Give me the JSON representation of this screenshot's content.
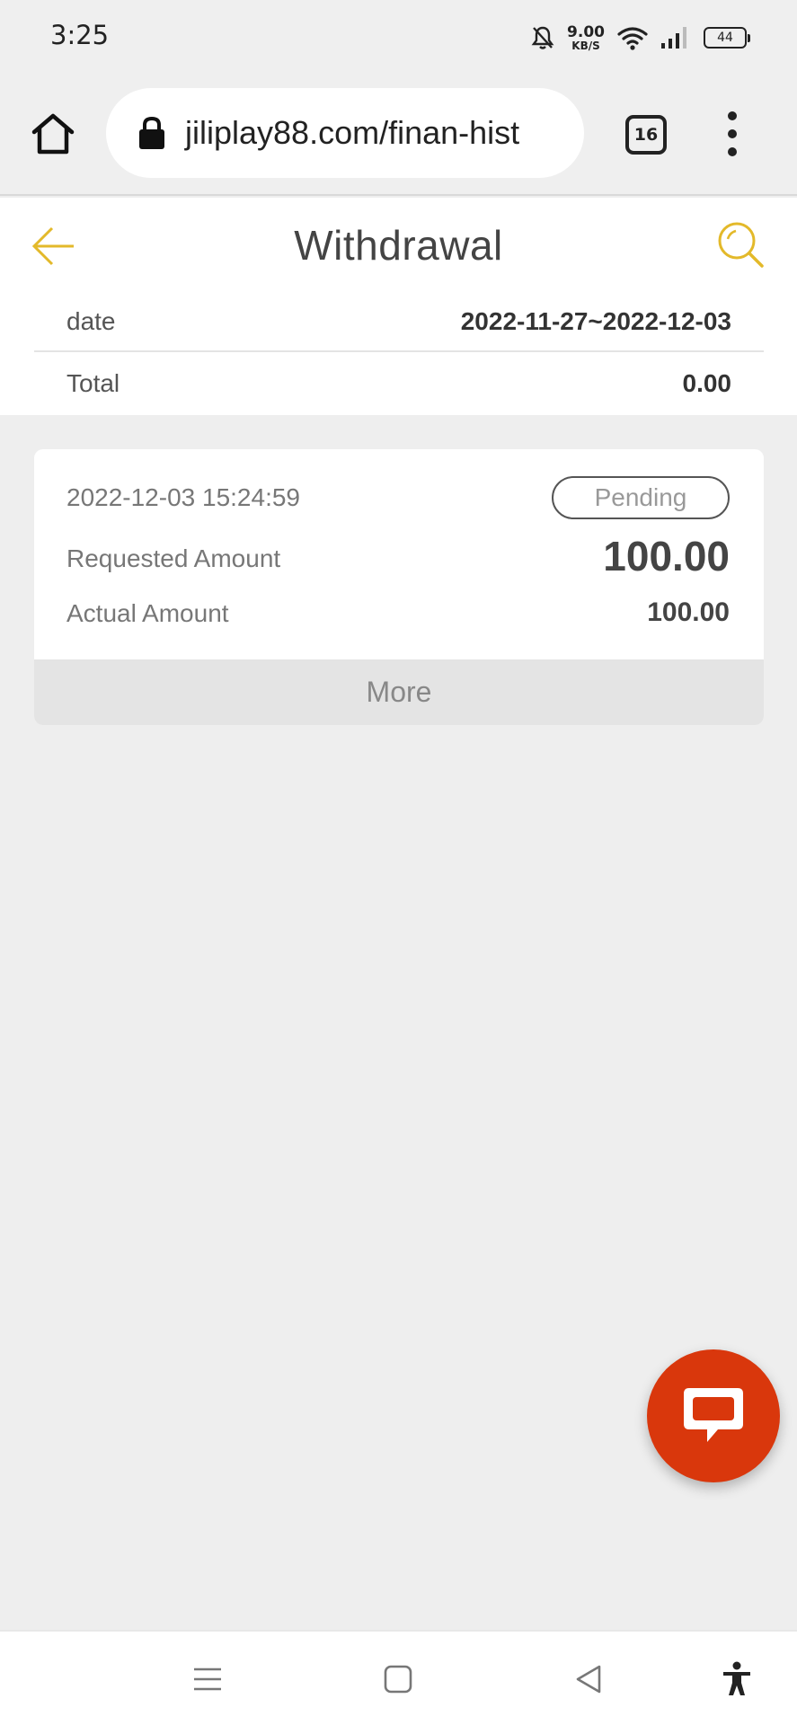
{
  "status_bar": {
    "time": "3:25",
    "net_speed_value": "9.00",
    "net_speed_unit": "KB/S",
    "battery": "44"
  },
  "browser": {
    "url": "jiliplay88.com/finan-hist",
    "tab_count": "16"
  },
  "header": {
    "title": "Withdrawal",
    "accent_color": "#e3b92a"
  },
  "summary": {
    "date_label": "date",
    "date_value": "2022-11-27~2022-12-03",
    "total_label": "Total",
    "total_value": "0.00"
  },
  "records": [
    {
      "timestamp": "2022-12-03 15:24:59",
      "status": "Pending",
      "requested_label": "Requested Amount",
      "requested_value": "100.00",
      "actual_label": "Actual Amount",
      "actual_value": "100.00",
      "more_label": "More"
    }
  ],
  "fab": {
    "icon": "chat-icon",
    "color": "#d9370c"
  },
  "nav_bar": {
    "icons": [
      "menu-icon",
      "home-square-icon",
      "back-triangle-icon",
      "accessibility-icon"
    ]
  }
}
